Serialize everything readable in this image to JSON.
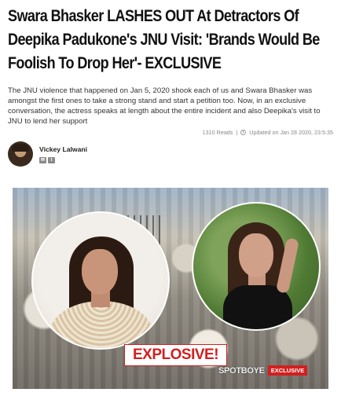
{
  "article": {
    "headline": "Swara Bhasker LASHES OUT At Detractors Of Deepika Padukone's JNU Visit: 'Brands Would Be Foolish To Drop Her'- EXCLUSIVE",
    "summary": "The JNU violence that happened on Jan 5, 2020 shook each of us and Swara Bhasker was amongst the first ones to take a strong stand and start a petition too. Now, in an exclusive conversation, the actress speaks at length about the entire incident and also Deepika's visit to JNU to lend her support",
    "reads": "1310 Reads",
    "separator": "|",
    "updated": "Updated on Jan 28 2020, 23:5:35"
  },
  "author": {
    "name": "Vickey Lalwani",
    "socials": [
      {
        "icon": "email-icon",
        "glyph": "✉"
      },
      {
        "icon": "twitter-icon",
        "glyph": "t"
      }
    ]
  },
  "hero_image": {
    "banner_text": "EXPLOSIVE!",
    "watermark_logo": "SPOTBOYE",
    "watermark_tag": "EXCLUSIVE"
  },
  "colors": {
    "accent": "#d31f1f",
    "text": "#111111",
    "muted": "#888888"
  }
}
